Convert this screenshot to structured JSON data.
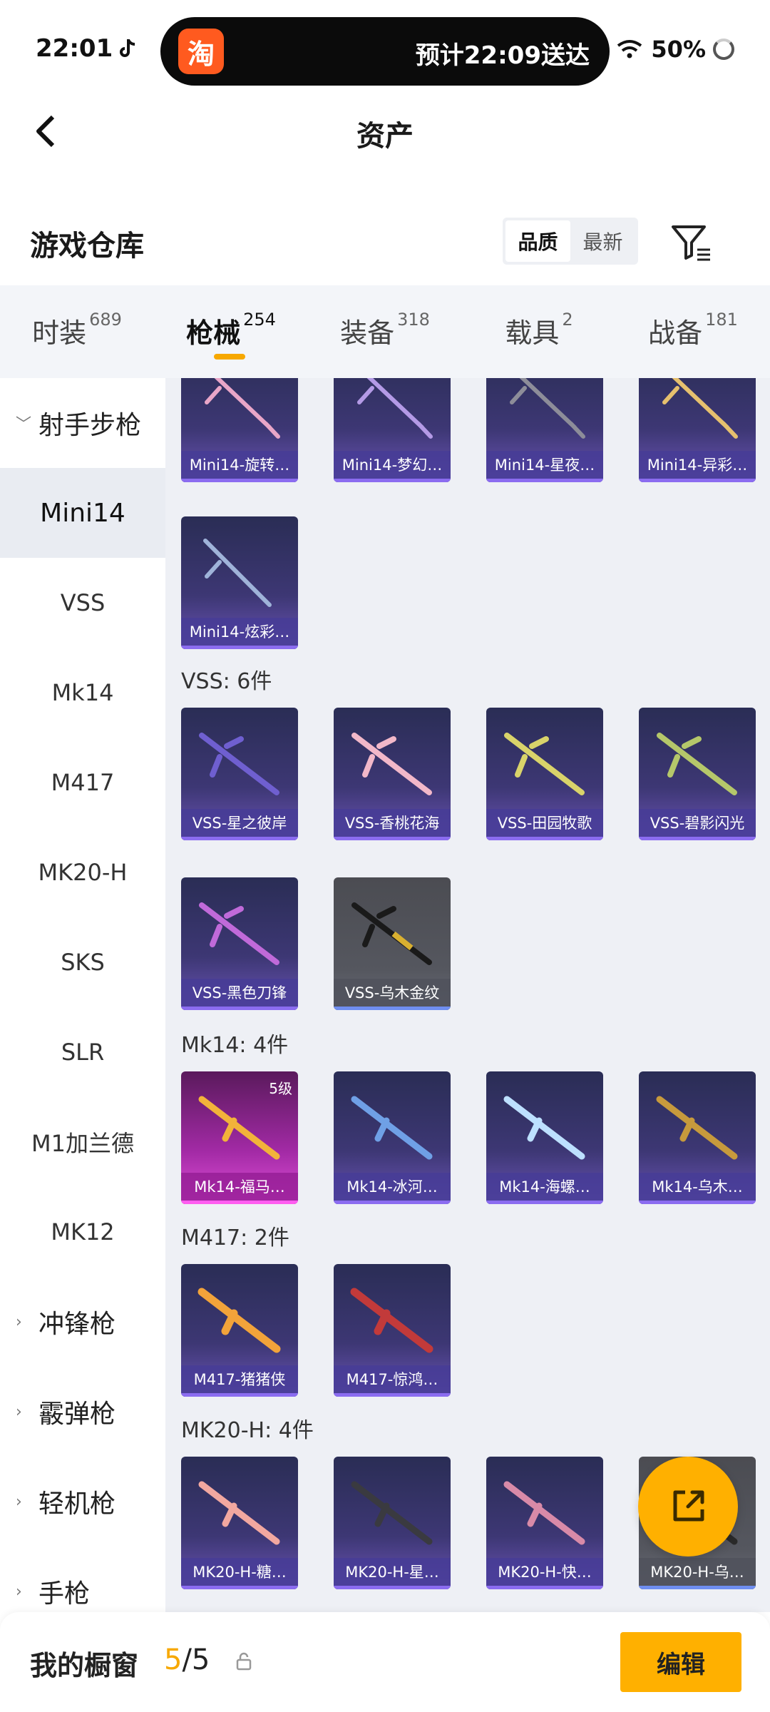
{
  "status_bar": {
    "time": "22:01",
    "tiktok_icon": "tiktok-icon",
    "taobao_badge": "淘",
    "delivery_text": "预计22:09送达",
    "battery": "50%"
  },
  "header": {
    "title": "资产"
  },
  "warehouse": {
    "title": "游戏仓库",
    "sort_options": [
      "品质",
      "最新"
    ],
    "active_sort": "品质"
  },
  "tabs": [
    {
      "label": "时装",
      "count": "689"
    },
    {
      "label": "枪械",
      "count": "254"
    },
    {
      "label": "装备",
      "count": "318"
    },
    {
      "label": "载具",
      "count": "2"
    },
    {
      "label": "战备",
      "count": "181"
    }
  ],
  "active_tab": "枪械",
  "sidebar": {
    "group_open": "射手步枪",
    "items": [
      "Mini14",
      "VSS",
      "Mk14",
      "M417",
      "MK20-H",
      "SKS",
      "SLR",
      "M1加兰德",
      "MK12"
    ],
    "selected": "Mini14",
    "groups_collapsed": [
      "冲锋枪",
      "霰弹枪",
      "轻机枪",
      "手枪"
    ]
  },
  "sections": [
    {
      "title": "",
      "items": [
        "Mini14-旋转…",
        "Mini14-梦幻…",
        "Mini14-星夜…",
        "Mini14-异彩…",
        "Mini14-炫彩…"
      ]
    },
    {
      "title": "VSS: 6件",
      "items": [
        "VSS-星之彼岸",
        "VSS-香桃花海",
        "VSS-田园牧歌",
        "VSS-碧影闪光",
        "VSS-黑色刀锋",
        "VSS-乌木金纹"
      ]
    },
    {
      "title": "Mk14: 4件",
      "items": [
        "Mk14-福马…",
        "Mk14-冰河…",
        "Mk14-海螺…",
        "Mk14-乌木…"
      ],
      "level_badge": "5级"
    },
    {
      "title": "M417: 2件",
      "items": [
        "M417-猪猪侠",
        "M417-惊鸿…"
      ]
    },
    {
      "title": "MK20-H: 4件",
      "items": [
        "MK20-H-糖…",
        "MK20-H-星…",
        "MK20-H-快…",
        "MK20-H-乌…"
      ]
    }
  ],
  "bottom": {
    "label": "我的橱窗",
    "current": "5",
    "total": "/5",
    "edit_label": "编辑"
  },
  "colors": {
    "accent": "#ffb000",
    "card": "#3d3774"
  }
}
